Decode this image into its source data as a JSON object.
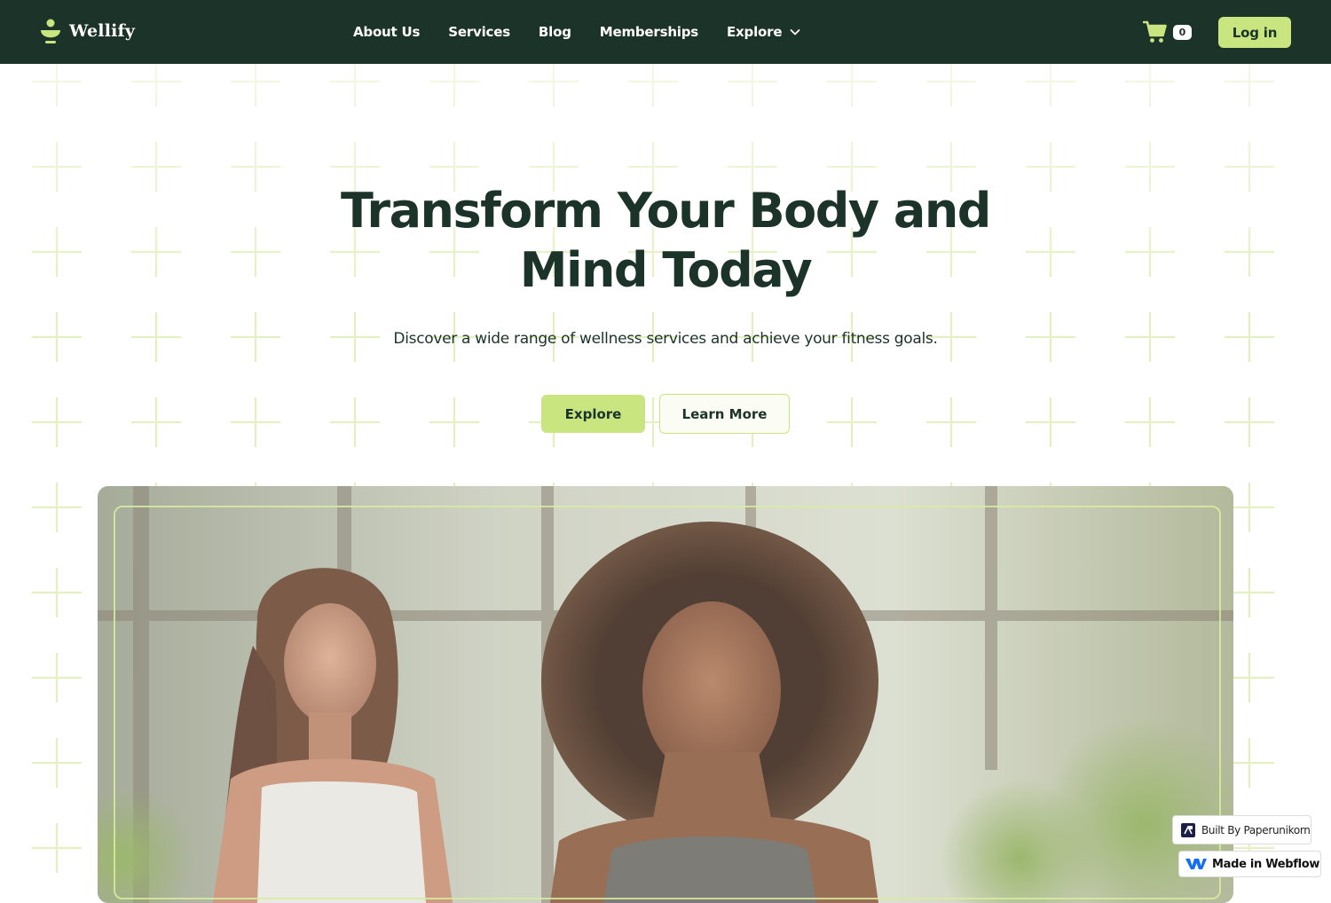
{
  "brand": {
    "name": "Wellify",
    "accent_color": "#c9e57f",
    "dark_color": "#1c3329",
    "logo_icon": "wellify-logo-icon"
  },
  "nav": {
    "links": [
      "About Us",
      "Services",
      "Blog",
      "Memberships"
    ],
    "explore_label": "Explore",
    "explore_icon": "chevron-down-icon"
  },
  "cart": {
    "icon": "cart-icon",
    "count": "0"
  },
  "login": {
    "label": "Log in"
  },
  "hero": {
    "title": "Transform Your Body and Mind Today",
    "subtitle": "Discover a wide range of wellness services and achieve your fitness goals.",
    "primary_button": "Explore",
    "secondary_button": "Learn More",
    "image": "hero-image-two-women-meditating"
  },
  "badges": {
    "built_by": "Built By Paperunikorn",
    "made_in": "Made in Webflow"
  }
}
